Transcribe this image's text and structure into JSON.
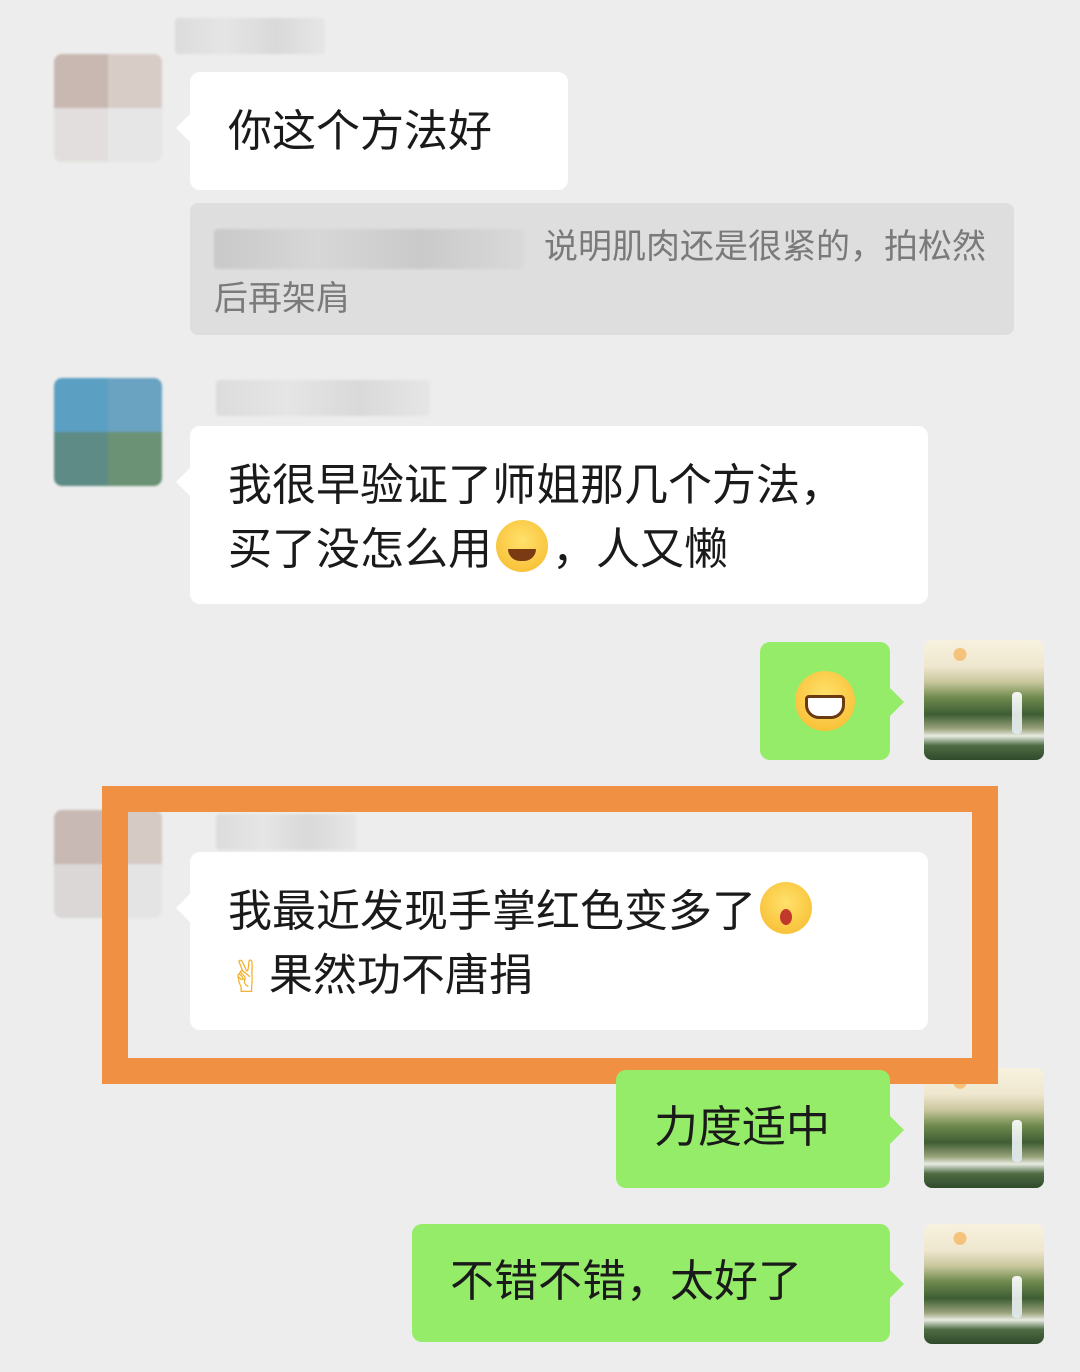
{
  "messages": [
    {
      "side": "left",
      "text": "你这个方法好"
    },
    {
      "side": "left",
      "quote": "说明肌肉还是很紧的，拍松然后再架肩"
    },
    {
      "side": "left",
      "line1": "我很早验证了师姐那几个方法，",
      "line2a": "买了没怎么用",
      "emoji": "face-palm-laugh",
      "line2b": "，人又懒"
    },
    {
      "side": "right",
      "emoji": "grinning-face"
    },
    {
      "side": "left",
      "line1": "我最近发现手掌红色变多了",
      "emoji1": "starstruck-face",
      "emoji2": "victory-hand",
      "line2": "果然功不唐捐",
      "highlighted": true
    },
    {
      "side": "right",
      "text": "力度适中"
    },
    {
      "side": "right",
      "text": "不错不错，太好了"
    }
  ],
  "colors": {
    "background": "#ededed",
    "incoming": "#ffffff",
    "outgoing": "#95ec69",
    "highlight": "#ef9042"
  },
  "icons": {
    "victory": "✌"
  }
}
